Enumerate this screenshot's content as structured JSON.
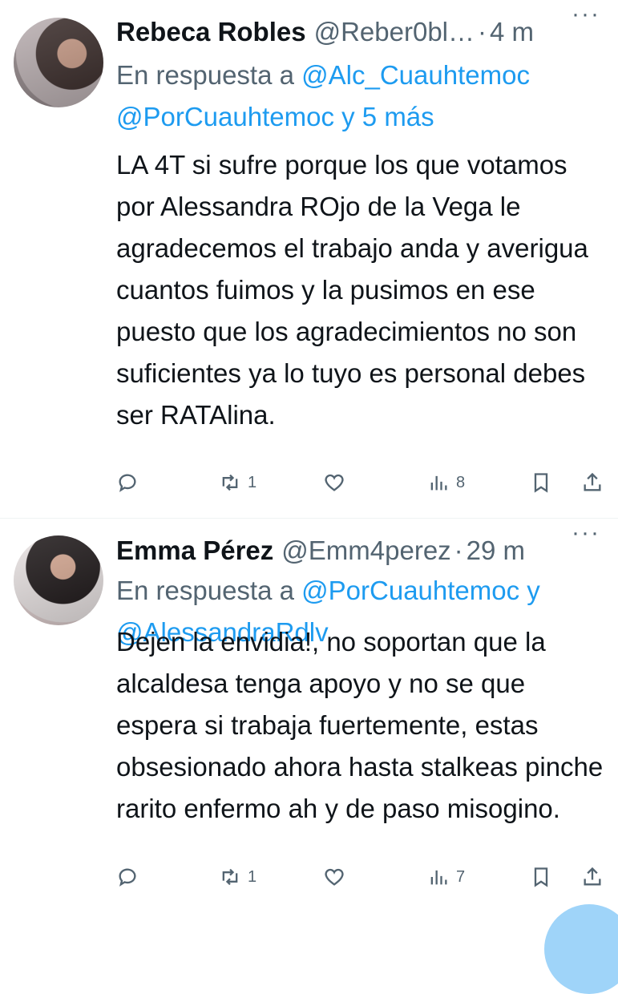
{
  "tweets": [
    {
      "name": "Rebeca Robles",
      "handle": "@Reber0bl…",
      "separator": "·",
      "time": "4 m",
      "more": "···",
      "reply_prefix": "En respuesta a",
      "reply_mentions": "@Alc_Cuauhtemoc @PorCuauhtemoc y 5 más",
      "text": "LA 4T si sufre porque los que votamos por Alessandra ROjo de la Vega le agradecemos el trabajo anda y averigua cuantos fuimos y la pusimos en ese puesto que los agradecimientos no son suficientes ya lo tuyo es personal debes ser RATAlina.",
      "retweets": "1",
      "views": "8"
    },
    {
      "name": "Emma Pérez",
      "handle": "@Emm4perez",
      "separator": "·",
      "time": "29 m",
      "more": "···",
      "reply_prefix": "En respuesta a",
      "reply_mentions": "@PorCuauhtemoc y @AlessandraRdlv",
      "text": "Dejen la envidia!, no soportan que la alcaldesa tenga apoyo y no se que espera si trabaja fuertemente, estas obsesionado ahora hasta stalkeas pinche rarito enfermo ah y de paso misogino.",
      "retweets": "1",
      "views": "7"
    }
  ],
  "icons": [
    "reply-icon",
    "retweet-icon",
    "like-icon",
    "views-icon",
    "bookmark-icon",
    "share-icon"
  ],
  "colors": {
    "link": "#1d9bf0",
    "muted": "#536471",
    "text": "#0f1419"
  }
}
